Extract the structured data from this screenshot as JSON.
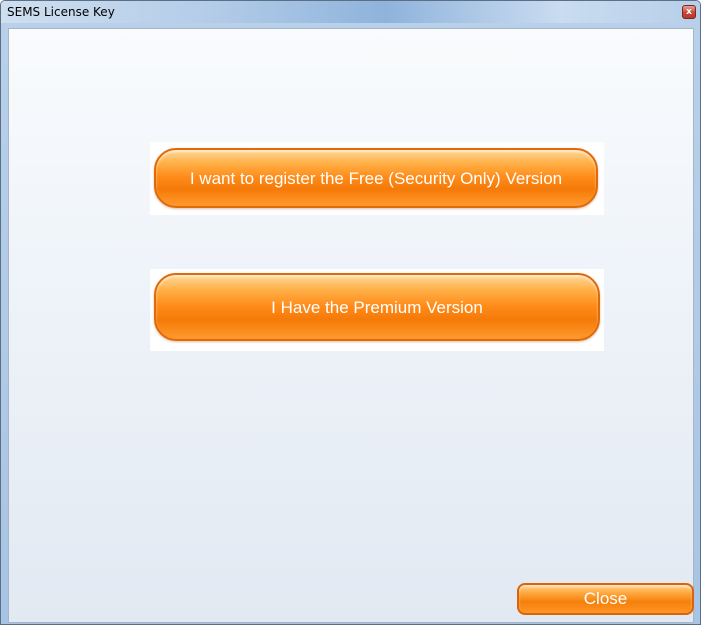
{
  "window": {
    "title": "SEMS License Key",
    "close_icon_glyph": "x"
  },
  "buttons": {
    "free_version_label": "I want to register the Free (Security Only) Version",
    "premium_version_label": "I Have the Premium Version",
    "close_label": "Close"
  },
  "colors": {
    "button_orange": "#f57a08",
    "button_border": "#e0690a",
    "title_bar_blue": "#b3cce8"
  }
}
